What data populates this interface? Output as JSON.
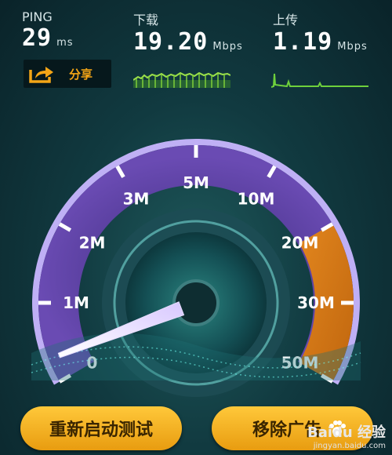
{
  "ping": {
    "label": "PING",
    "value": "29",
    "unit": "ms"
  },
  "download": {
    "label": "下载",
    "value": "19.20",
    "unit": "Mbps"
  },
  "upload": {
    "label": "上传",
    "value": "1.19",
    "unit": "Mbps"
  },
  "share": {
    "label": "分享",
    "icon": "share-icon"
  },
  "gauge": {
    "labels": [
      "0",
      "1M",
      "2M",
      "3M",
      "5M",
      "10M",
      "20M",
      "30M",
      "50M"
    ],
    "needle_value": "0.3M",
    "highlight_from": "20M",
    "highlight_to": "50M"
  },
  "buttons": {
    "restart": "重新启动测试",
    "remove_ads": "移除广告"
  },
  "watermark": {
    "text": "Baidu 经验",
    "url": "jingyan.baidu.com"
  },
  "colors": {
    "accent": "#f4a516",
    "dial": "#5b3fa0",
    "graph": "#9be04a",
    "button": "#f5b32a"
  }
}
